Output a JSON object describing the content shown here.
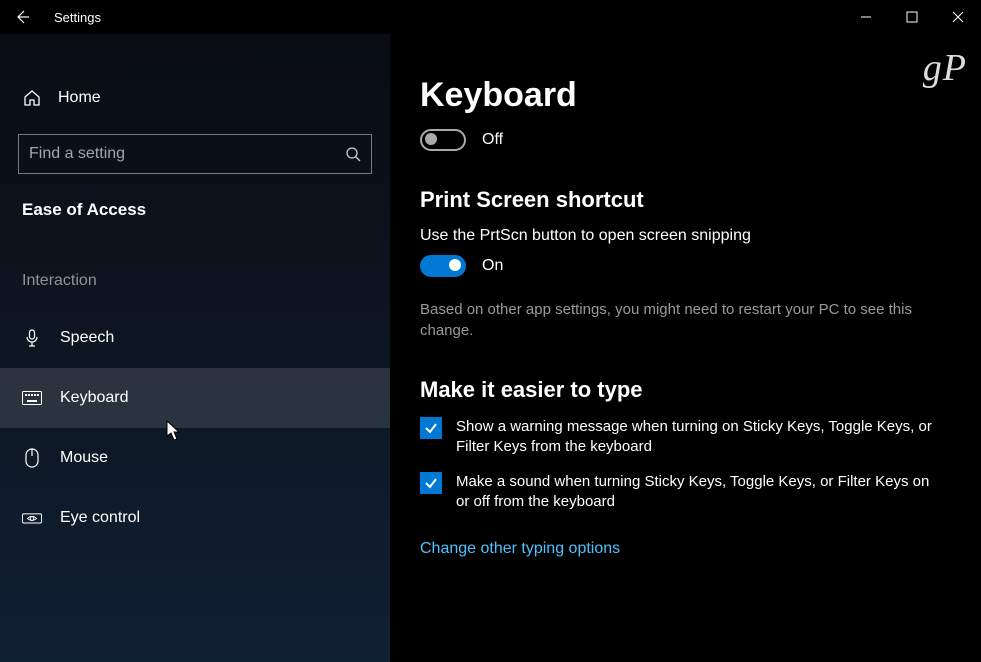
{
  "titlebar": {
    "title": "Settings"
  },
  "watermark": "gP",
  "sidebar": {
    "home": "Home",
    "search_placeholder": "Find a setting",
    "category": "Ease of Access",
    "group": "Interaction",
    "items": [
      {
        "label": "Speech"
      },
      {
        "label": "Keyboard"
      },
      {
        "label": "Mouse"
      },
      {
        "label": "Eye control"
      }
    ]
  },
  "main": {
    "title": "Keyboard",
    "toggle1": {
      "on": false,
      "label": "Off"
    },
    "section1": {
      "title": "Print Screen shortcut",
      "desc": "Use the PrtScn button to open screen snipping",
      "toggle": {
        "on": true,
        "label": "On"
      },
      "hint": "Based on other app settings, you might need to restart your PC to see this change."
    },
    "section2": {
      "title": "Make it easier to type",
      "checks": [
        "Show a warning message when turning on Sticky Keys, Toggle Keys, or Filter Keys from the keyboard",
        "Make a sound when turning Sticky Keys, Toggle Keys, or Filter Keys on or off from the keyboard"
      ],
      "link": "Change other typing options"
    }
  }
}
